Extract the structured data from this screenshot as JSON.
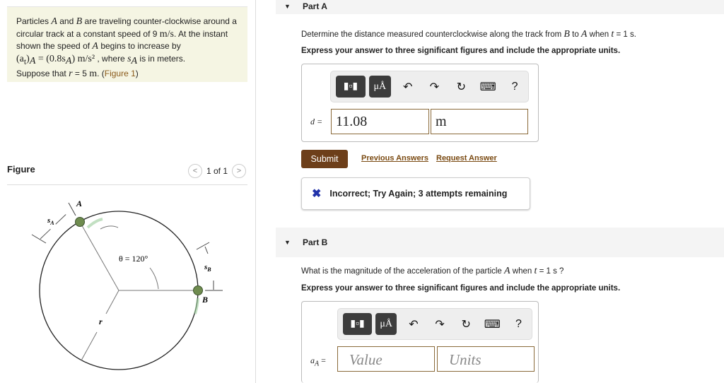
{
  "problem": {
    "t1": "Particles ",
    "A": "A",
    "t2": " and ",
    "B": "B",
    "t3": " are traveling counter-clockwise around a circular track at a constant speed of 9 ",
    "ms": "m/s",
    "t4": ". At the instant shown the speed of ",
    "t5": " begins to increase by ",
    "eq": "(a",
    "eqt": "t",
    "eq2": ")",
    "eqA": "A",
    "eq3": " = (0.8s",
    "eq4": ") m/s²",
    "t6": " , where ",
    "sA": "s",
    "t7": " is in meters.",
    "t8": "Suppose that ",
    "r": "r",
    "t9": " = 5 ",
    "mu": "m",
    "t10": ". (",
    "fig_link": "Figure 1",
    "t11": ")"
  },
  "figure": {
    "title": "Figure",
    "pager": "1 of 1",
    "labels": {
      "A": "A",
      "B": "B",
      "sA": "s",
      "sAsub": "A",
      "sB": "s",
      "sBsub": "B",
      "theta": "θ = 120°",
      "r": "r"
    }
  },
  "partA": {
    "title": "Part A",
    "question": {
      "p1": "Determine the distance measured counterclockwise along the track from ",
      "B": "B",
      "p2": " to ",
      "A": "A",
      "p3": " when ",
      "t": "t",
      "p4": " = 1 s."
    },
    "instructions": "Express your answer to three significant figures and include the appropriate units.",
    "label": "d =",
    "value": "11.08",
    "units": "m",
    "submit": "Submit",
    "prev": "Previous Answers",
    "request": "Request Answer",
    "feedback": "Incorrect; Try Again; 3 attempts remaining"
  },
  "partB": {
    "title": "Part B",
    "question": {
      "p1": "What is the magnitude of the acceleration of the particle ",
      "A": "A",
      "p2": " when ",
      "t": "t",
      "p3": " = 1 s ?"
    },
    "instructions": "Express your answer to three significant figures and include the appropriate units.",
    "label": "a",
    "labelsub": "A",
    "labeleq": " =",
    "value_ph": "Value",
    "units_ph": "Units"
  },
  "toolbar": {
    "units": "μÅ",
    "help": "?"
  },
  "colors": {
    "accent": "#6d3f1a",
    "link": "#7a4a12",
    "problem_bg": "#f5f5e3"
  }
}
